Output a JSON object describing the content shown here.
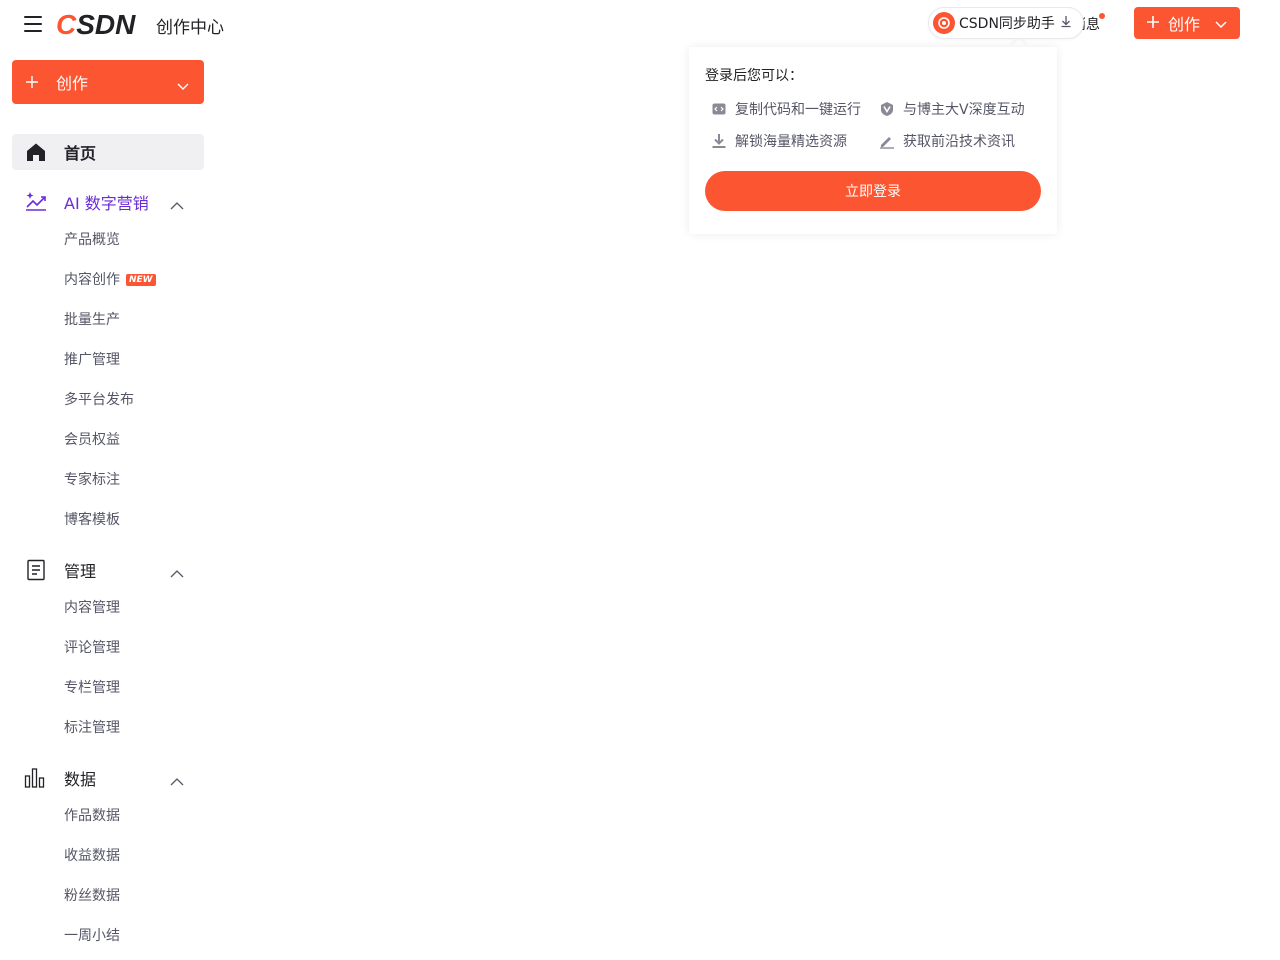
{
  "header": {
    "site_title": "创作中心",
    "sync_helper_label": "CSDN同步助手",
    "message_label": "消息",
    "create_label": "创作"
  },
  "popover": {
    "heading": "登录后您可以：",
    "benefits": [
      {
        "label": "复制代码和一键运行",
        "icon": "code-icon"
      },
      {
        "label": "与博主大V深度互动",
        "icon": "v-badge-icon"
      },
      {
        "label": "解锁海量精选资源",
        "icon": "download-icon"
      },
      {
        "label": "获取前沿技术资讯",
        "icon": "pen-icon"
      }
    ],
    "login_button": "立即登录"
  },
  "sidebar": {
    "create_label": "创作",
    "home_label": "首页",
    "groups": [
      {
        "label": "AI 数字营销",
        "icon": "trend-sparkle-icon",
        "expanded": true,
        "items": [
          {
            "label": "产品概览"
          },
          {
            "label": "内容创作",
            "badge": "NEW"
          },
          {
            "label": "批量生产"
          },
          {
            "label": "推广管理"
          },
          {
            "label": "多平台发布"
          },
          {
            "label": "会员权益"
          },
          {
            "label": "专家标注"
          },
          {
            "label": "博客模板"
          }
        ]
      },
      {
        "label": "管理",
        "icon": "document-icon",
        "expanded": true,
        "items": [
          {
            "label": "内容管理"
          },
          {
            "label": "评论管理"
          },
          {
            "label": "专栏管理"
          },
          {
            "label": "标注管理"
          }
        ]
      },
      {
        "label": "数据",
        "icon": "bar-chart-icon",
        "expanded": true,
        "items": [
          {
            "label": "作品数据"
          },
          {
            "label": "收益数据"
          },
          {
            "label": "粉丝数据"
          },
          {
            "label": "一周小结"
          }
        ]
      }
    ]
  },
  "colors": {
    "brand": "#fc5531",
    "active_group": "#6b2bd6",
    "text_primary": "#222226",
    "text_secondary": "#555666"
  }
}
